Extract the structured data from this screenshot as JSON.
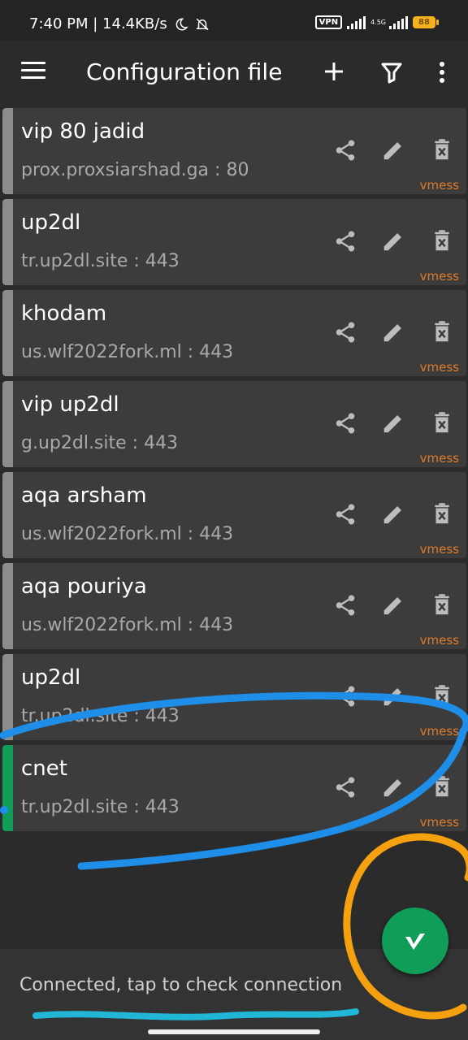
{
  "status_bar": {
    "time": "7:40 PM | 14.4KB/s",
    "vpn": "VPN",
    "network": "4.5G",
    "battery": "88"
  },
  "app_bar": {
    "title": "Configuration file",
    "icons": [
      "menu-icon",
      "add-icon",
      "filter-icon",
      "more-vert-icon"
    ]
  },
  "servers": [
    {
      "name": "vip 80 jadid",
      "address": "prox.proxsiarshad.ga : 80",
      "type": "vmess",
      "selected": false
    },
    {
      "name": "up2dl",
      "address": "tr.up2dl.site : 443",
      "type": "vmess",
      "selected": false
    },
    {
      "name": "khodam",
      "address": "us.wlf2022fork.ml : 443",
      "type": "vmess",
      "selected": false
    },
    {
      "name": "vip up2dl",
      "address": "g.up2dl.site : 443",
      "type": "vmess",
      "selected": false
    },
    {
      "name": "aqa arsham",
      "address": "us.wlf2022fork.ml : 443",
      "type": "vmess",
      "selected": false
    },
    {
      "name": "aqa pouriya",
      "address": "us.wlf2022fork.ml : 443",
      "type": "vmess",
      "selected": false
    },
    {
      "name": "up2dl",
      "address": "tr.up2dl.site : 443",
      "type": "vmess",
      "selected": false
    },
    {
      "name": "cnet",
      "address": "tr.up2dl.site : 443",
      "type": "vmess",
      "selected": true
    }
  ],
  "row_actions": [
    "share-icon",
    "edit-icon",
    "delete-icon"
  ],
  "footer": {
    "status_text": "Connected, tap to check connection"
  },
  "colors": {
    "accent_green": "#0f9d58",
    "type_orange": "#e07b2a",
    "annotation_blue": "#1e8ee8",
    "annotation_orange": "#f5a00f"
  }
}
